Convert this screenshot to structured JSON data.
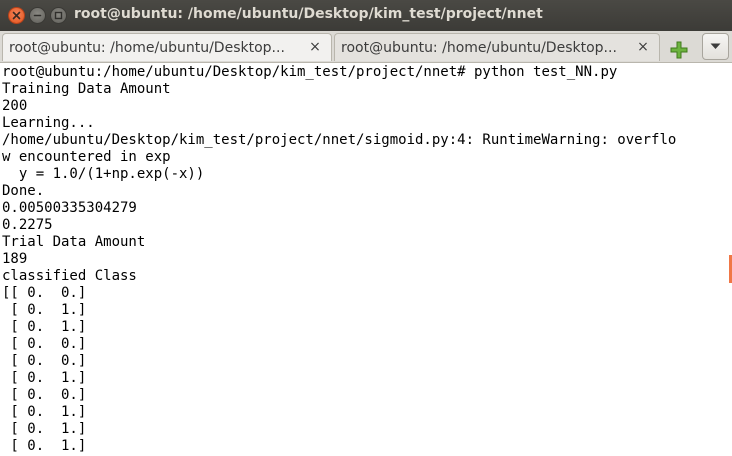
{
  "window": {
    "title": "root@ubuntu: /home/ubuntu/Desktop/kim_test/project/nnet",
    "buttons": {
      "close_icon": "close-icon",
      "minimize_icon": "minimize-icon",
      "maximize_icon": "maximize-icon"
    }
  },
  "tabs": [
    {
      "label": "root@ubuntu: /home/ubuntu/Desktop...",
      "close": "×"
    },
    {
      "label": "root@ubuntu: /home/ubuntu/Desktop...",
      "close": "×"
    }
  ],
  "toolbar": {
    "new_tab_icon": "plus-icon",
    "menu_icon": "chevron-down-icon"
  },
  "colors": {
    "titlebar": "#3c3b37",
    "accent": "#f07746",
    "new_tab_green": "#5aa02c"
  },
  "terminal": {
    "lines": [
      "root@ubuntu:/home/ubuntu/Desktop/kim_test/project/nnet# python test_NN.py",
      "Training Data Amount",
      "200",
      "Learning...",
      "/home/ubuntu/Desktop/kim_test/project/nnet/sigmoid.py:4: RuntimeWarning: overflo",
      "w encountered in exp",
      "  y = 1.0/(1+np.exp(-x))",
      "Done.",
      "0.00500335304279",
      "0.2275",
      "Trial Data Amount",
      "189",
      "classified Class",
      "[[ 0.  0.]",
      " [ 0.  1.]",
      " [ 0.  1.]",
      " [ 0.  0.]",
      " [ 0.  0.]",
      " [ 0.  1.]",
      " [ 0.  0.]",
      " [ 0.  1.]",
      " [ 0.  1.]",
      " [ 0.  1.]"
    ]
  }
}
